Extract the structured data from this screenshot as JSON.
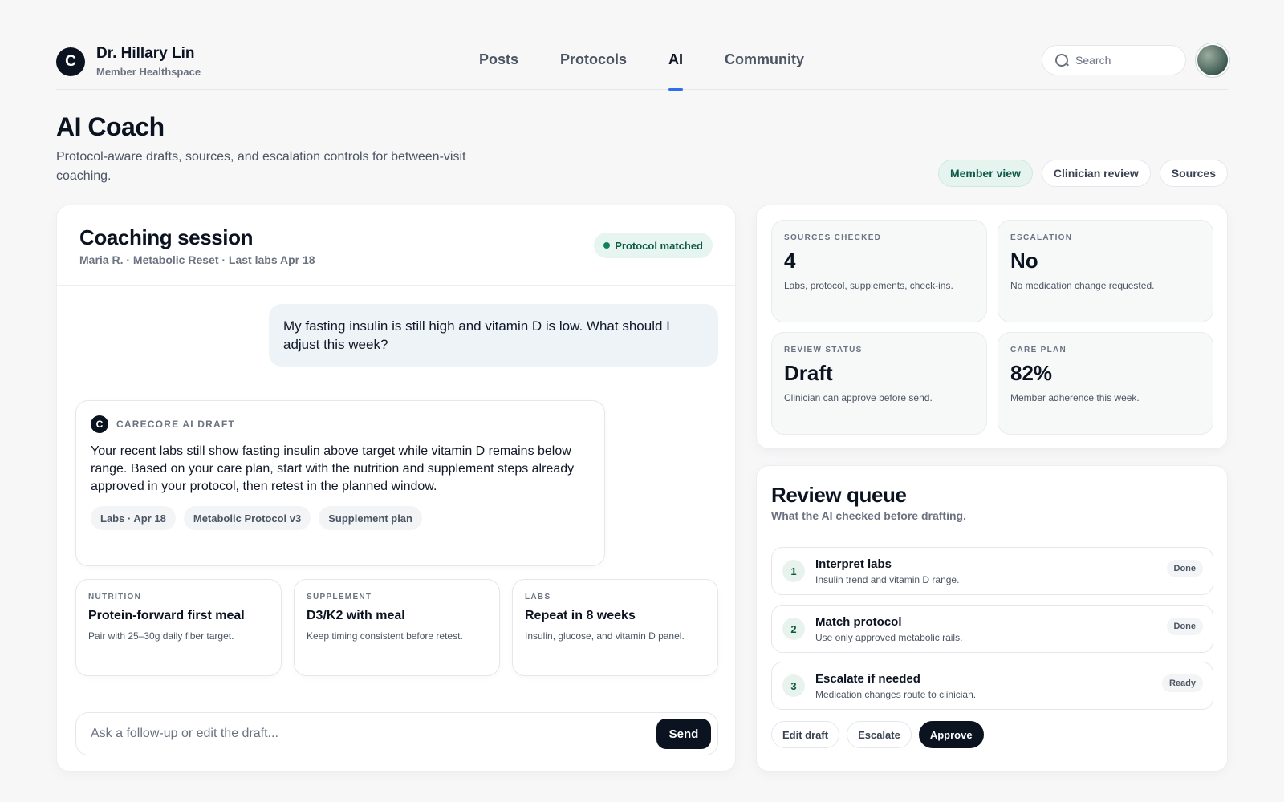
{
  "brand": {
    "logo_letter": "C",
    "name": "Dr. Hillary Lin",
    "subtitle": "Member Healthspace"
  },
  "nav": {
    "items": [
      {
        "label": "Posts"
      },
      {
        "label": "Protocols"
      },
      {
        "label": "AI",
        "active": true
      },
      {
        "label": "Community"
      }
    ]
  },
  "search": {
    "placeholder": "Search",
    "icon": "search-icon"
  },
  "page": {
    "title": "AI Coach",
    "subtitle": "Protocol-aware drafts, sources, and escalation controls for between-visit coaching.",
    "views": [
      {
        "label": "Member view",
        "active": true
      },
      {
        "label": "Clinician review"
      },
      {
        "label": "Sources"
      }
    ]
  },
  "session": {
    "title": "Coaching session",
    "meta": "Maria R. · Metabolic Reset · Last labs Apr 18",
    "badge": "Protocol matched",
    "user_message": "My fasting insulin is still high and vitamin D is low. What should I adjust this week?",
    "draft": {
      "logo_letter": "C",
      "label": "CARECORE AI DRAFT",
      "text": "Your recent labs still show fasting insulin above target while vitamin D remains below range. Based on your care plan, start with the nutrition and supplement steps already approved in your protocol, then retest in the planned window.",
      "sources": [
        "Labs · Apr 18",
        "Metabolic Protocol v3",
        "Supplement plan"
      ]
    },
    "recommendations": [
      {
        "eyebrow": "NUTRITION",
        "title": "Protein-forward first meal",
        "desc": "Pair with 25–30g daily fiber target."
      },
      {
        "eyebrow": "SUPPLEMENT",
        "title": "D3/K2 with meal",
        "desc": "Keep timing consistent before retest."
      },
      {
        "eyebrow": "LABS",
        "title": "Repeat in 8 weeks",
        "desc": "Insulin, glucose, and vitamin D panel."
      }
    ],
    "composer_placeholder": "Ask a follow-up or edit the draft...",
    "send_label": "Send"
  },
  "stats": [
    {
      "label": "SOURCES CHECKED",
      "value": "4",
      "desc": "Labs, protocol, supplements, check-ins."
    },
    {
      "label": "ESCALATION",
      "value": "No",
      "desc": "No medication change requested."
    },
    {
      "label": "REVIEW STATUS",
      "value": "Draft",
      "desc": "Clinician can approve before send."
    },
    {
      "label": "CARE PLAN",
      "value": "82%",
      "desc": "Member adherence this week."
    }
  ],
  "queue": {
    "title": "Review queue",
    "subtitle": "What the AI checked before drafting.",
    "items": [
      {
        "num": "1",
        "title": "Interpret labs",
        "desc": "Insulin trend and vitamin D range.",
        "status": "Done"
      },
      {
        "num": "2",
        "title": "Match protocol",
        "desc": "Use only approved metabolic rails.",
        "status": "Done"
      },
      {
        "num": "3",
        "title": "Escalate if needed",
        "desc": "Medication changes route to clinician.",
        "status": "Ready"
      }
    ],
    "actions": {
      "edit": "Edit draft",
      "escalate": "Escalate",
      "approve": "Approve"
    }
  },
  "colors": {
    "accent": "#2f6fed",
    "primary": "#0b1220",
    "success": "#11815f",
    "success_bg": "#e7f5f0"
  }
}
